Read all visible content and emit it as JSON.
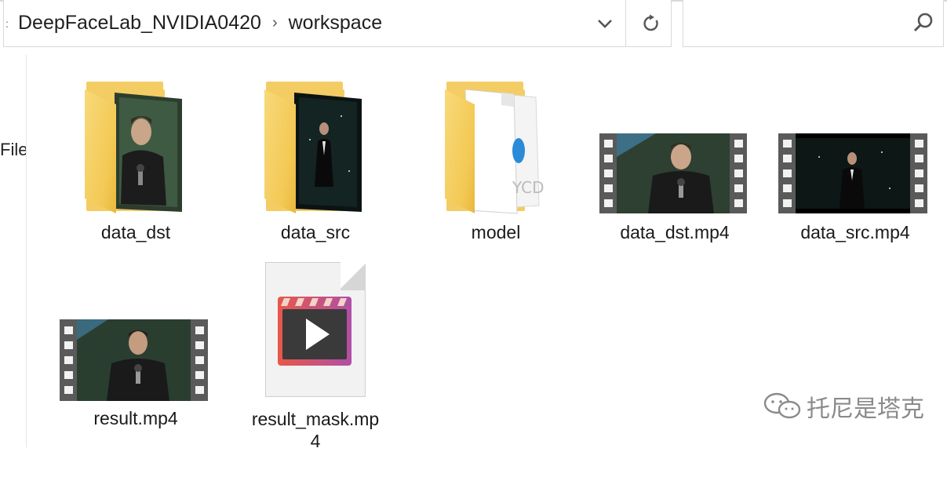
{
  "address_bar": {
    "edge_glyph": ":",
    "breadcrumbs": [
      "DeepFaceLab_NVIDIA0420",
      "workspace"
    ],
    "separator": "›",
    "dropdown_icon": "chevron-down-icon",
    "refresh_icon": "refresh-icon"
  },
  "search": {
    "placeholder": "",
    "icon": "search-icon"
  },
  "nav_pane": {
    "partial_label": "File"
  },
  "items": [
    {
      "name": "data_dst",
      "type": "folder"
    },
    {
      "name": "data_src",
      "type": "folder"
    },
    {
      "name": "model",
      "type": "folder"
    },
    {
      "name": "data_dst.mp4",
      "type": "video"
    },
    {
      "name": "data_src.mp4",
      "type": "video"
    },
    {
      "name": "result.mp4",
      "type": "video"
    },
    {
      "name_line1": "result_mask.mp",
      "name_line2": "4",
      "type": "video-file"
    }
  ],
  "watermark": {
    "text": "托尼是塔克"
  },
  "colors": {
    "folder_yellow": "#f3cc63",
    "border": "#d9d9d9",
    "film": "#5a5a5a"
  }
}
